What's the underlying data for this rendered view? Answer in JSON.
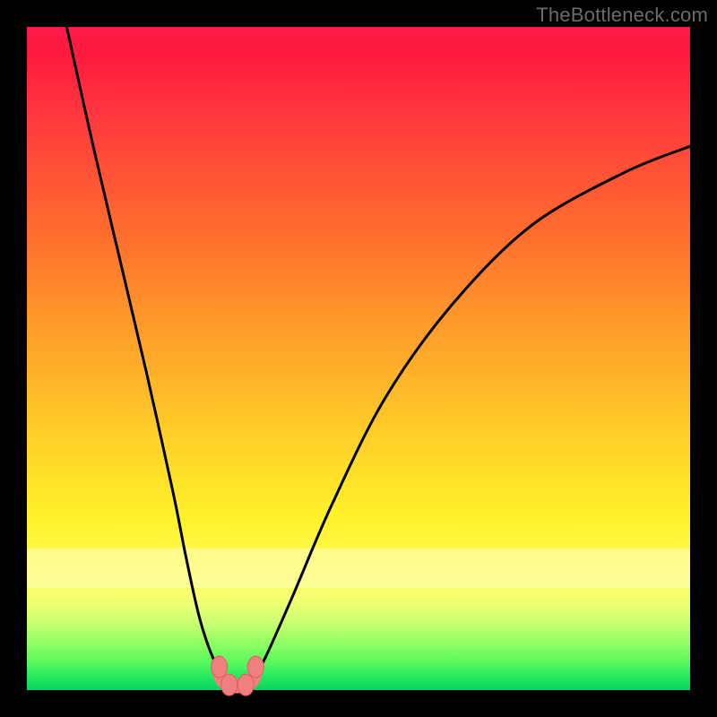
{
  "watermark": "TheBottleneck.com",
  "colors": {
    "frame": "#000000",
    "gradient_top": "#ff1a4d",
    "gradient_mid": "#ffd028",
    "gradient_bottom": "#0ad45f",
    "marker": "#f07f7f",
    "curve": "#000000"
  },
  "chart_data": {
    "type": "line",
    "title": "",
    "xlabel": "",
    "ylabel": "",
    "xlim": [
      0,
      100
    ],
    "ylim": [
      0,
      100
    ],
    "grid": false,
    "series": [
      {
        "name": "bottleneck-curve",
        "x": [
          6,
          10,
          14,
          18,
          22,
          24,
          26,
          28,
          30,
          31,
          32,
          33,
          34,
          36,
          40,
          46,
          54,
          64,
          76,
          90,
          100
        ],
        "y": [
          100,
          82,
          65,
          48,
          30,
          20,
          11,
          5,
          1.5,
          0.5,
          0.3,
          0.5,
          1.5,
          5,
          14,
          28,
          44,
          58,
          70,
          78,
          82
        ]
      }
    ],
    "markers": [
      {
        "name": "left-marker",
        "x": 29.0,
        "y": 3.5
      },
      {
        "name": "minimum-left",
        "x": 30.5,
        "y": 0.8
      },
      {
        "name": "minimum-right",
        "x": 33.0,
        "y": 0.8
      },
      {
        "name": "right-marker",
        "x": 34.5,
        "y": 3.5
      }
    ],
    "marker_band_y": 2.0
  }
}
